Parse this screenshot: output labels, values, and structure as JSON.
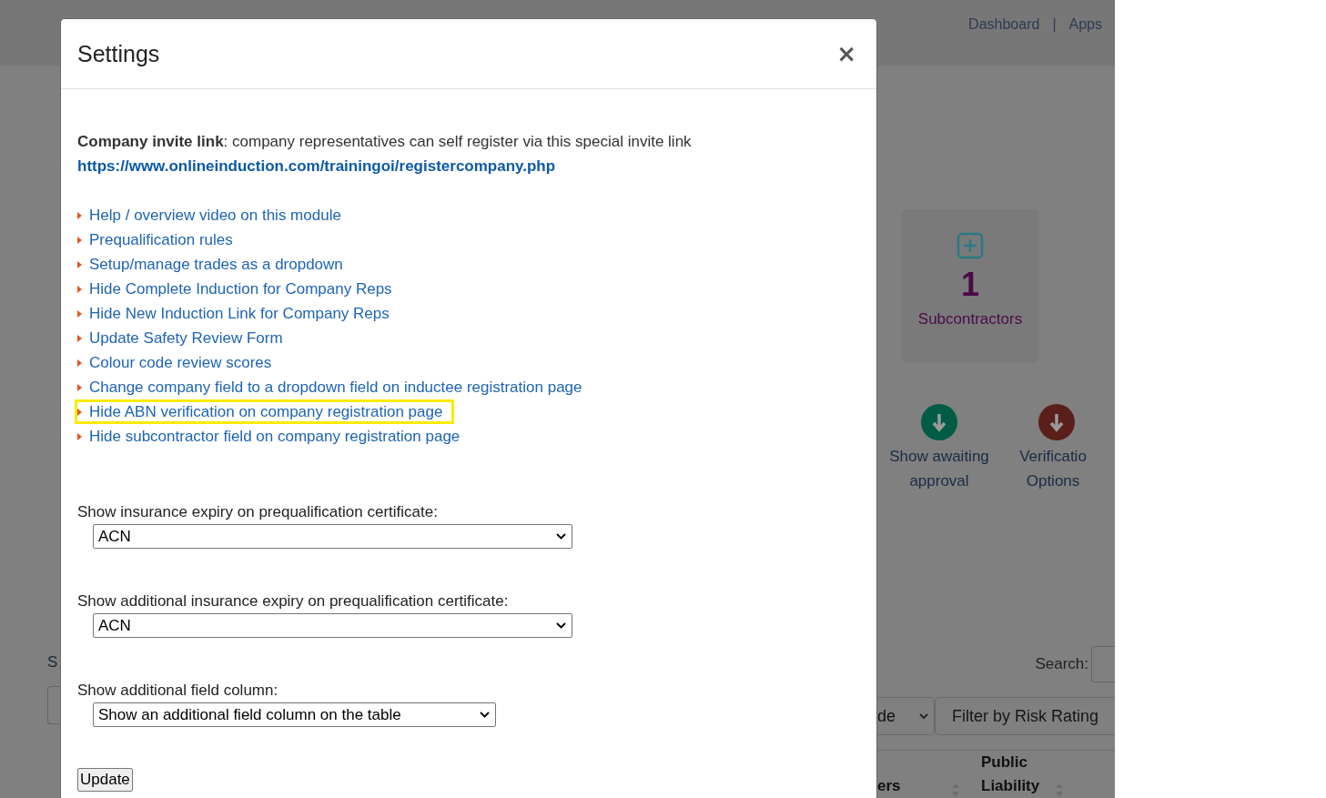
{
  "background": {
    "nav_links": [
      "Dashboard",
      "Apps"
    ],
    "nav_separator": "|",
    "fragments": {
      "left_label": "S"
    },
    "stat_card": {
      "count": "1",
      "label": "Subcontractors"
    },
    "actions": [
      {
        "label": "Show awaiting approval",
        "color": "#005c45"
      },
      {
        "label": "Verificatio Options",
        "color": "#5a1f1a"
      }
    ],
    "search_label": "Search:",
    "filters": [
      {
        "value": "de",
        "kind": "select"
      },
      {
        "value": "Filter by Risk Rating",
        "kind": "input"
      }
    ],
    "table_headers": [
      "ers",
      "Public Liability"
    ]
  },
  "modal": {
    "title": "Settings",
    "close": "×",
    "invite": {
      "label": "Company invite link",
      "text": ": company representatives can self register via this special invite link",
      "url": "https://www.onlineinduction.com/trainingoi/registercompany.php"
    },
    "links": [
      {
        "label": "Help / overview video on this module",
        "highlighted": false
      },
      {
        "label": "Prequalification rules",
        "highlighted": false
      },
      {
        "label": "Setup/manage trades as a dropdown",
        "highlighted": false
      },
      {
        "label": "Hide Complete Induction for Company Reps",
        "highlighted": false
      },
      {
        "label": "Hide New Induction Link for Company Reps",
        "highlighted": false
      },
      {
        "label": "Update Safety Review Form",
        "highlighted": false
      },
      {
        "label": "Colour code review scores",
        "highlighted": false
      },
      {
        "label": "Change company field to a dropdown field on inductee registration page",
        "highlighted": false
      },
      {
        "label": "Hide ABN verification on company registration page",
        "highlighted": true
      },
      {
        "label": "Hide subcontractor field on company registration page",
        "highlighted": false
      }
    ],
    "fields": [
      {
        "label": "Show insurance expiry on prequalification certificate:",
        "value": "ACN",
        "wide": true
      },
      {
        "label": "Show additional insurance expiry on prequalification certificate:",
        "value": "ACN",
        "wide": true
      },
      {
        "label": "Show additional field column:",
        "value": "Show an additional field column on the table",
        "wide": false
      }
    ],
    "submit": "Update"
  }
}
